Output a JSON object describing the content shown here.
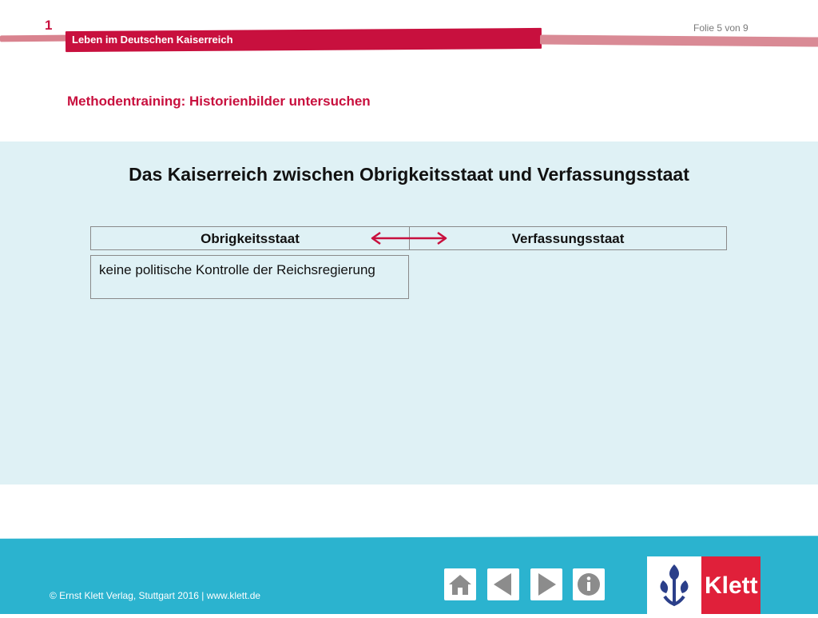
{
  "header": {
    "chapter_number": "1",
    "folio": "Folie 5 von 9",
    "band_title": "Leben im Deutschen Kaiserreich",
    "subtitle": "Methodentraining: Historienbilder untersuchen"
  },
  "main": {
    "heading": "Das Kaiserreich zwischen Obrigkeitsstaat und Verfassungsstaat",
    "table": {
      "columns": [
        "Obrigkeitsstaat",
        "Verfassungsstaat"
      ],
      "left_cell": "keine politische Kontrolle der Reichsregierung"
    }
  },
  "footer": {
    "copyright": "© Ernst Klett Verlag, Stuttgart 2016 | www.klett.de",
    "buttons": [
      "home-icon",
      "previous-icon",
      "next-icon",
      "info-icon"
    ],
    "logo_text": "Klett"
  },
  "colors": {
    "brand_red": "#c8103e",
    "panel_bg": "#dff1f5",
    "footer_blue": "#2bb3cf",
    "klett_red": "#e0203a"
  }
}
